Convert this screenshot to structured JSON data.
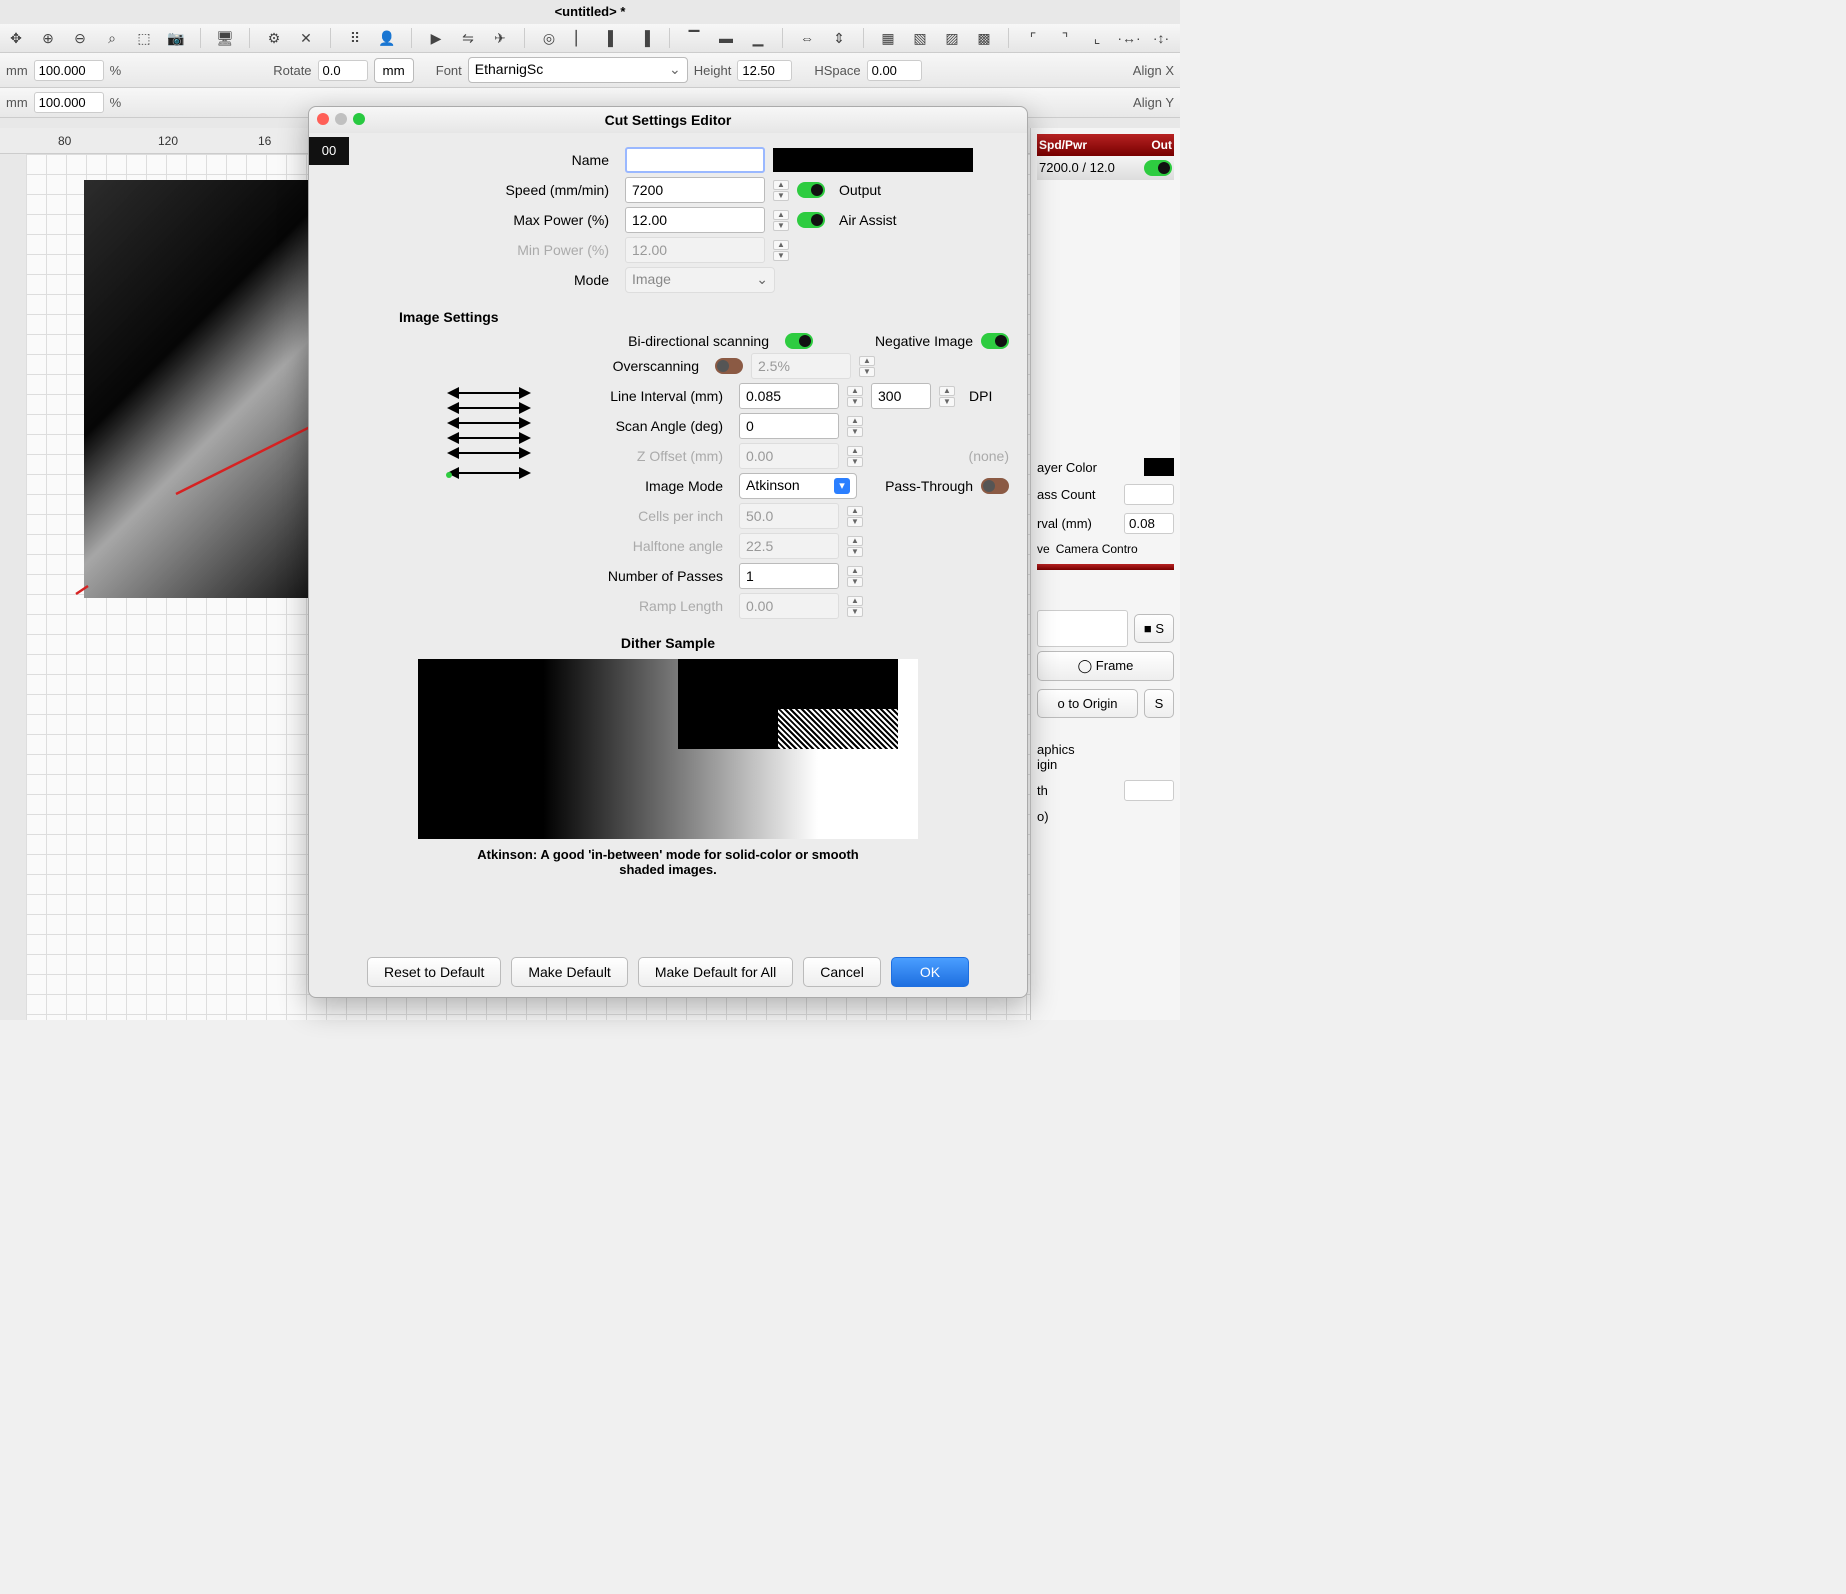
{
  "window_title": "<untitled> *",
  "prop": {
    "mm1": "mm",
    "val1": "100.000",
    "pct1": "%",
    "mm2": "mm",
    "val2": "100.000",
    "pct2": "%",
    "rotate_label": "Rotate",
    "rotate_val": "0.0",
    "units_btn": "mm",
    "font_label": "Font",
    "font_val": "EtharnigSc",
    "height_label": "Height",
    "height_val": "12.50",
    "hspace_label": "HSpace",
    "hspace_val": "0.00",
    "alignx": "Align X",
    "aligny": "Align Y"
  },
  "ruler": {
    "t1": "80",
    "t2": "120",
    "t3": "16"
  },
  "right": {
    "col1": "Spd/Pwr",
    "col2": "Out",
    "row_val": "7200.0 / 12.0",
    "layer_color": "ayer Color",
    "pass_count": "ass Count",
    "interval": "rval (mm)",
    "interval_val": "0.08",
    "tab_move": "ve",
    "tab_camera": "Camera Contro",
    "btn_s": "S",
    "btn_frame": "Frame",
    "btn_goorigin": "o to Origin",
    "btn_s2": "S",
    "aphics": "aphics",
    "igin": "igin",
    "th": "th",
    "o_paren": "o)"
  },
  "modal": {
    "title": "Cut Settings Editor",
    "tab": "00",
    "name_label": "Name",
    "name_val": "",
    "speed_label": "Speed (mm/min)",
    "speed_val": "7200",
    "maxpower_label": "Max Power (%)",
    "maxpower_val": "12.00",
    "minpower_label": "Min Power (%)",
    "minpower_val": "12.00",
    "mode_label": "Mode",
    "mode_val": "Image",
    "output_label": "Output",
    "airassist_label": "Air Assist",
    "section_image": "Image Settings",
    "bidir_label": "Bi-directional scanning",
    "negative_label": "Negative Image",
    "overscan_label": "Overscanning",
    "overscan_val": "2.5%",
    "lineint_label": "Line Interval (mm)",
    "lineint_val": "0.085",
    "dpi_val": "300",
    "dpi_label": "DPI",
    "scanangle_label": "Scan Angle (deg)",
    "scanangle_val": "0",
    "zoffset_label": "Z Offset (mm)",
    "zoffset_val": "0.00",
    "zoffset_dpi": "(none)",
    "imagemode_label": "Image Mode",
    "imagemode_val": "Atkinson",
    "passthrough_label": "Pass-Through",
    "cellspi_label": "Cells per inch",
    "cellspi_val": "50.0",
    "halftone_label": "Halftone angle",
    "halftone_val": "22.5",
    "numpasses_label": "Number of Passes",
    "numpasses_val": "1",
    "ramplen_label": "Ramp Length",
    "ramplen_val": "0.00",
    "dither_title": "Dither Sample",
    "dither_desc": "Atkinson: A good 'in-between' mode for solid-color or smooth shaded images.",
    "btn_reset": "Reset to Default",
    "btn_makedef": "Make Default",
    "btn_makedefall": "Make Default for All",
    "btn_cancel": "Cancel",
    "btn_ok": "OK"
  }
}
